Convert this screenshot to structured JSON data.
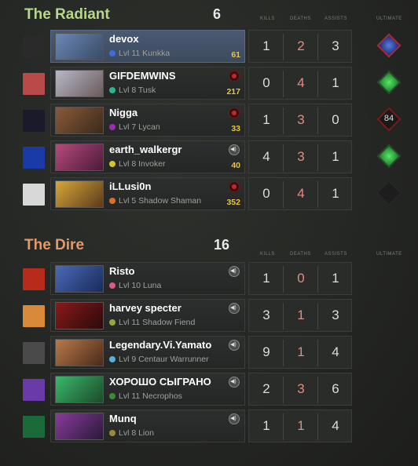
{
  "radiant": {
    "title": "The Radiant",
    "score": "6",
    "title_color": "#b5d88a",
    "headers": {
      "kills": "KILLS",
      "deaths": "DEATHS",
      "assists": "ASSISTS",
      "ultimate": "ULTIMATE"
    },
    "players": [
      {
        "name": "devox",
        "info": "Lvl 11 Kunkka",
        "gold": "61",
        "kills": "1",
        "deaths": "2",
        "assists": "3",
        "indicator": "none",
        "ult": "blue-ready",
        "active": true,
        "dot": "#3b6ed8"
      },
      {
        "name": "GIFDEMWINS",
        "info": "Lvl 8 Tusk",
        "gold": "217",
        "kills": "0",
        "deaths": "4",
        "assists": "1",
        "indicator": "red",
        "ult": "green-ready",
        "active": false,
        "dot": "#29b58f"
      },
      {
        "name": "Nigga",
        "info": "Lvl 7 Lycan",
        "gold": "33",
        "kills": "1",
        "deaths": "3",
        "assists": "0",
        "indicator": "red",
        "ult": "cooldown",
        "ult_text": "84",
        "active": false,
        "dot": "#9c2bb5"
      },
      {
        "name": "earth_walkergr",
        "info": "Lvl 8 Invoker",
        "gold": "40",
        "kills": "4",
        "deaths": "3",
        "assists": "1",
        "indicator": "speaker",
        "ult": "green-ready",
        "active": false,
        "dot": "#d8c32a"
      },
      {
        "name": "iLLusi0n",
        "info": "Lvl 5 Shadow Shaman",
        "gold": "352",
        "kills": "0",
        "deaths": "4",
        "assists": "1",
        "indicator": "red",
        "ult": "empty",
        "active": false,
        "dot": "#d8702a"
      }
    ]
  },
  "dire": {
    "title": "The Dire",
    "score": "16",
    "title_color": "#e39a6a",
    "headers": {
      "kills": "KILLS",
      "deaths": "DEATHS",
      "assists": "ASSISTS",
      "ultimate": "ULTIMATE"
    },
    "players": [
      {
        "name": "Risto",
        "info": "Lvl 10 Luna",
        "kills": "1",
        "deaths": "0",
        "assists": "1",
        "indicator": "speaker",
        "dot": "#d85a8a"
      },
      {
        "name": "harvey specter",
        "info": "Lvl 11 Shadow Fiend",
        "kills": "3",
        "deaths": "1",
        "assists": "3",
        "indicator": "speaker",
        "dot": "#9aa83a"
      },
      {
        "name": "Legendary.Vi.Yamato",
        "info": "Lvl 9 Centaur Warrunner",
        "kills": "9",
        "deaths": "1",
        "assists": "4",
        "indicator": "speaker",
        "dot": "#5ab0d8"
      },
      {
        "name": "ХОРОШО СЫГРАНО",
        "info": "Lvl 11 Necrophos",
        "kills": "2",
        "deaths": "3",
        "assists": "6",
        "indicator": "speaker",
        "dot": "#3a8a3a"
      },
      {
        "name": "Munq",
        "info": "Lvl 8 Lion",
        "kills": "1",
        "deaths": "1",
        "assists": "4",
        "indicator": "speaker",
        "dot": "#9a8a3a"
      }
    ]
  }
}
